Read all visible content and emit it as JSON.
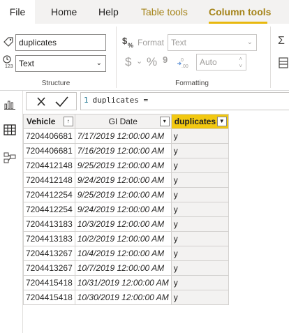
{
  "menu": {
    "file": "File",
    "home": "Home",
    "help": "Help",
    "table_tools": "Table tools",
    "column_tools": "Column tools"
  },
  "ribbon": {
    "structure": {
      "name_value": "duplicates",
      "data_type": "Text",
      "label": "Structure"
    },
    "formatting": {
      "format_label": "Format",
      "format_value": "Text",
      "currency_symbol": "$",
      "percent_symbol": "%",
      "comma_symbol": "9",
      "decimals_value": "Auto",
      "label": "Formatting"
    },
    "overflow": {
      "sigma": "Σ"
    }
  },
  "formula": {
    "line_number": "1",
    "expression": "duplicates ="
  },
  "table": {
    "columns": [
      {
        "label": "Vehicle",
        "icon": "sort-ascending-icon"
      },
      {
        "label": "GI Date",
        "icon": "dropdown-icon"
      },
      {
        "label": "duplicates",
        "icon": "filter-icon"
      }
    ],
    "rows": [
      {
        "vehicle": "7204406681",
        "gi_date": "7/17/2019 12:00:00 AM",
        "dup": "y"
      },
      {
        "vehicle": "7204406681",
        "gi_date": "7/16/2019 12:00:00 AM",
        "dup": "y"
      },
      {
        "vehicle": "7204412148",
        "gi_date": "9/25/2019 12:00:00 AM",
        "dup": "y"
      },
      {
        "vehicle": "7204412148",
        "gi_date": "9/24/2019 12:00:00 AM",
        "dup": "y"
      },
      {
        "vehicle": "7204412254",
        "gi_date": "9/25/2019 12:00:00 AM",
        "dup": "y"
      },
      {
        "vehicle": "7204412254",
        "gi_date": "9/24/2019 12:00:00 AM",
        "dup": "y"
      },
      {
        "vehicle": "7204413183",
        "gi_date": "10/3/2019 12:00:00 AM",
        "dup": "y"
      },
      {
        "vehicle": "7204413183",
        "gi_date": "10/2/2019 12:00:00 AM",
        "dup": "y"
      },
      {
        "vehicle": "7204413267",
        "gi_date": "10/4/2019 12:00:00 AM",
        "dup": "y"
      },
      {
        "vehicle": "7204413267",
        "gi_date": "10/7/2019 12:00:00 AM",
        "dup": "y"
      },
      {
        "vehicle": "7204415418",
        "gi_date": "10/31/2019 12:00:00 AM",
        "dup": "y"
      },
      {
        "vehicle": "7204415418",
        "gi_date": "10/30/2019 12:00:00 AM",
        "dup": "y"
      }
    ]
  },
  "colors": {
    "accent": "#f2c811",
    "tab_text_gold": "#a5841a"
  }
}
